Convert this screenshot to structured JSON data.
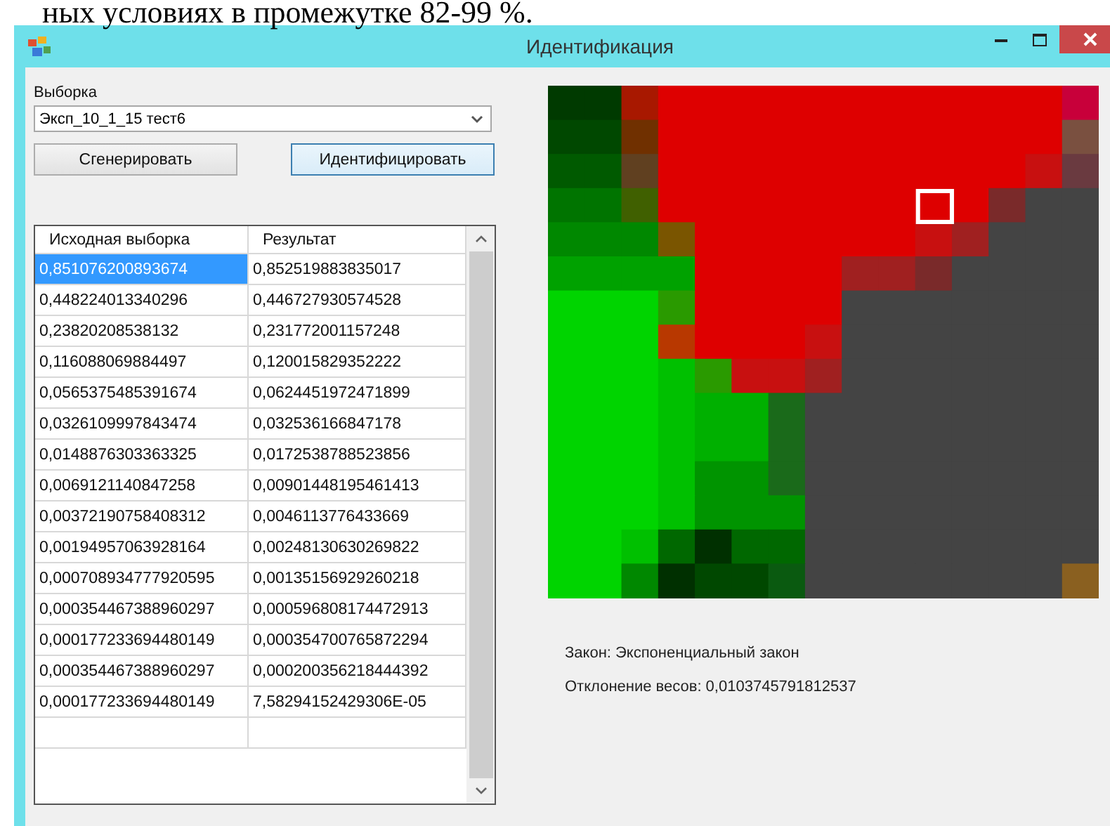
{
  "document_text": "ных условиях в промежутке 82-99 %.",
  "window": {
    "title": "Идентификация"
  },
  "sample": {
    "label": "Выборка",
    "value": "Эксп_10_1_15 тест6"
  },
  "buttons": [
    {
      "label": "Сгенерировать",
      "focused": false
    },
    {
      "label": "Идентифицировать",
      "focused": true
    }
  ],
  "table": {
    "columns": [
      "Исходная выборка",
      "Результат"
    ],
    "rows": [
      {
        "source": "0,851076200893674",
        "result": "0,852519883835017",
        "selected": true
      },
      {
        "source": "0,448224013340296",
        "result": "0,446727930574528",
        "selected": false
      },
      {
        "source": "0,23820208538132",
        "result": "0,231772001157248",
        "selected": false
      },
      {
        "source": "0,116088069884497",
        "result": "0,120015829352222",
        "selected": false
      },
      {
        "source": "0,0565375485391674",
        "result": "0,0624451972471899",
        "selected": false
      },
      {
        "source": "0,0326109997843474",
        "result": "0,032536166847178",
        "selected": false
      },
      {
        "source": "0,0148876303363325",
        "result": "0,0172538788523856",
        "selected": false
      },
      {
        "source": "0,0069121140847258",
        "result": "0,00901448195461413",
        "selected": false
      },
      {
        "source": "0,00372190758408312",
        "result": "0,0046113776433669",
        "selected": false
      },
      {
        "source": "0,00194957063928164",
        "result": "0,00248130630269822",
        "selected": false
      },
      {
        "source": "0,000708934777920595",
        "result": "0,00135156929260218",
        "selected": false
      },
      {
        "source": "0,000354467388960297",
        "result": "0,000596808174472913",
        "selected": false
      },
      {
        "source": "0,000177233694480149",
        "result": "0,000354700765872294",
        "selected": false
      },
      {
        "source": "0,000354467388960297",
        "result": "0,000200356218444392",
        "selected": false
      },
      {
        "source": "0,000177233694480149",
        "result": "7,58294152429306E-05",
        "selected": false
      }
    ]
  },
  "results": [
    "Закон: Экспоненциальный закон",
    "Отклонение весов: 0,0103745791812537"
  ]
}
